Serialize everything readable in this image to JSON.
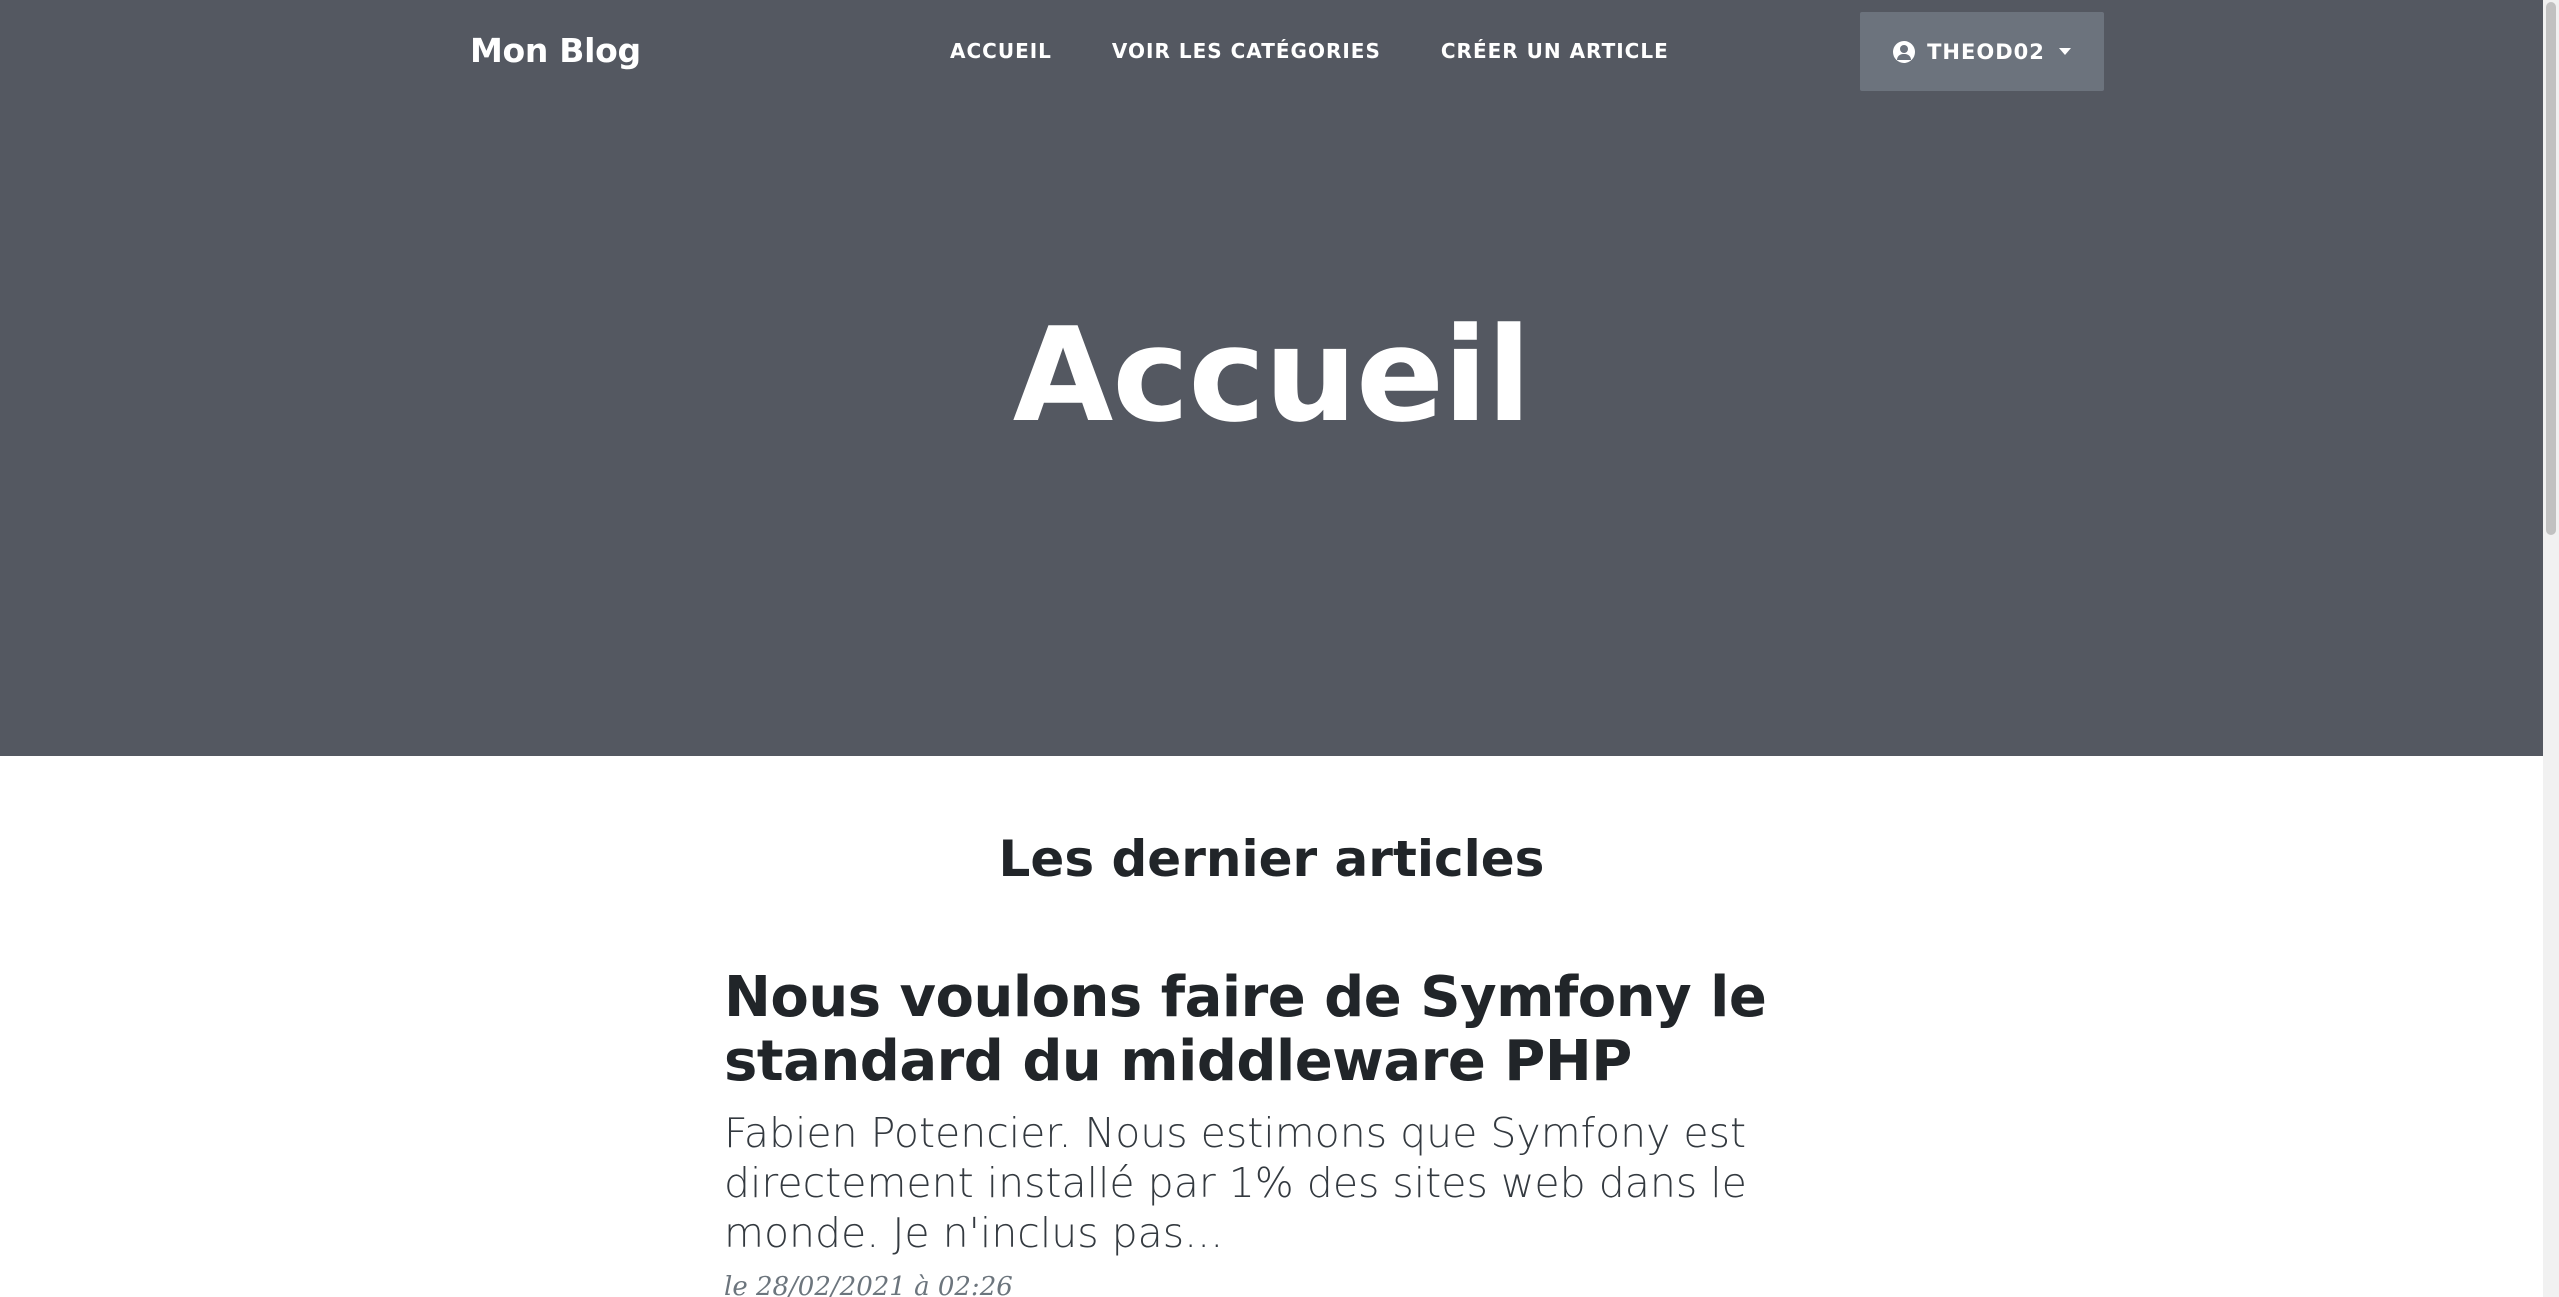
{
  "navbar": {
    "brand": "Mon Blog",
    "links": [
      "ACCUEIL",
      "VOIR LES CATÉGORIES",
      "CRÉER UN ARTICLE"
    ],
    "user": {
      "name": "THEOD02",
      "icon": "user-circle-icon",
      "dropdown_icon": "caret-down-icon"
    }
  },
  "hero": {
    "title": "Accueil"
  },
  "content": {
    "section_title": "Les dernier articles",
    "posts": [
      {
        "title": "Nous voulons faire de Symfony le standard du middleware PHP",
        "subtitle": "Fabien Potencier. Nous estimons que Symfony est directement installé par 1% des sites web dans le monde. Je n'inclus pas...",
        "meta": "le 28/02/2021 à 02:26"
      }
    ]
  },
  "colors": {
    "header_bg": "#545861",
    "dropdown_bg": "#6c737d",
    "text_dark": "#212529"
  }
}
